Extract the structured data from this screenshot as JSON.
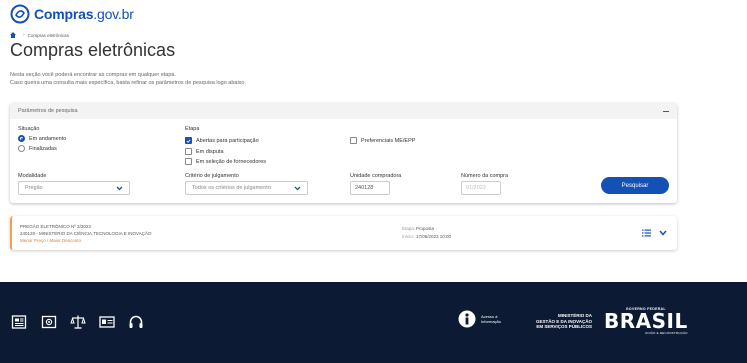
{
  "header": {
    "logo_main": "Compras",
    "logo_suffix": ".gov.br"
  },
  "breadcrumb": {
    "current": "Compras eletrônicas"
  },
  "page": {
    "title": "Compras eletrônicas",
    "desc_line1": "Nesta seção você poderá encontrar as compras em qualquer etapa.",
    "desc_line2": "Caso queira uma consulta mais específica, basta refinar os parâmetros de pesquisa logo abaixo."
  },
  "panel": {
    "title": "Parâmetros de pesquisa",
    "situacao": {
      "label": "Situação",
      "options": [
        "Em andamento",
        "Finalizadas"
      ],
      "selected": "Em andamento"
    },
    "etapa": {
      "label": "Etapa",
      "options": [
        {
          "label": "Abertas para participação",
          "checked": true
        },
        {
          "label": "Em disputa",
          "checked": false
        },
        {
          "label": "Em seleção de fornecedores",
          "checked": false
        }
      ]
    },
    "preferencias": {
      "label": "Preferenciais ME/EPP",
      "checked": false
    },
    "modalidade": {
      "label": "Modalidade",
      "value": "Pregão"
    },
    "criterio": {
      "label": "Critério de julgamento",
      "value": "Todos os critérios de julgamento"
    },
    "unidade": {
      "label": "Unidade compradora",
      "value": "240128"
    },
    "numero": {
      "label": "Número da compra",
      "placeholder": "01/2022"
    },
    "search_label": "Pesquisar"
  },
  "result": {
    "title": "PREGÃO ELETRÔNICO Nº 2/2023",
    "subtitle": "240128 - MINISTÉRIO DA CIÊNCIA,TECNOLOGIA E INOVAÇÃO",
    "tag": "Menor Preço / Maior Desconto",
    "etapa_key": "Etapa:",
    "etapa_value": "Proposta",
    "inicio_key": "Início:",
    "inicio_value": "17/05/2023 10:00"
  },
  "footer": {
    "access_line1": "Acesso à",
    "access_line2": "Informação",
    "ministry_line1": "MINISTÉRIO DA",
    "ministry_line2": "GESTÃO E DA INOVAÇÃO",
    "ministry_line3": "EM SERVIÇOS PÚBLICOS",
    "gov_label": "GOVERNO FEDERAL",
    "brasil": "BRASIL",
    "slogan": "UNIÃO E RECONSTRUÇÃO"
  },
  "colors": {
    "primary": "#1351b4",
    "footer_bg": "#0c1b33",
    "accent_orange": "#e07b3a"
  }
}
